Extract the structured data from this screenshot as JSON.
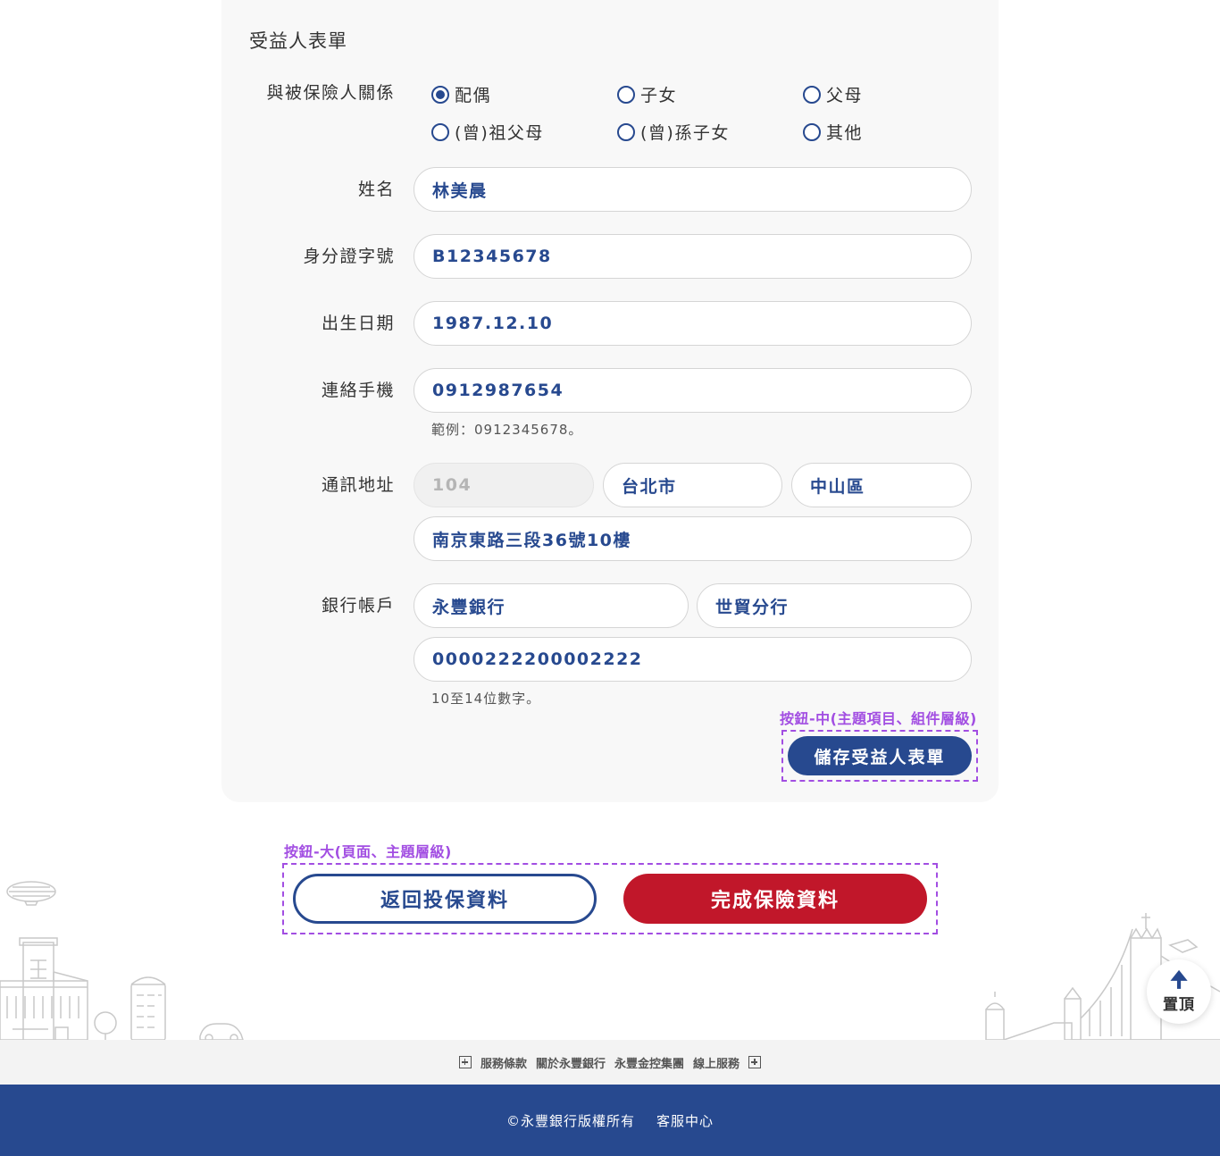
{
  "form": {
    "title": "受益人表單",
    "relation": {
      "label": "與被保險人關係",
      "options": [
        {
          "label": "配偶",
          "checked": true
        },
        {
          "label": "子女",
          "checked": false
        },
        {
          "label": "父母",
          "checked": false
        },
        {
          "label": "(曾)祖父母",
          "checked": false
        },
        {
          "label": "(曾)孫子女",
          "checked": false
        },
        {
          "label": "其他",
          "checked": false
        }
      ]
    },
    "name": {
      "label": "姓名",
      "value": "林美晨"
    },
    "id_number": {
      "label": "身分證字號",
      "value": "B12345678"
    },
    "birthday": {
      "label": "出生日期",
      "value": "1987.12.10"
    },
    "mobile": {
      "label": "連絡手機",
      "value": "0912987654",
      "hint": "範例：0912345678。"
    },
    "address": {
      "label": "通訊地址",
      "zip": "104",
      "city": "台北市",
      "district": "中山區",
      "street": "南京東路三段36號10樓"
    },
    "bank": {
      "label": "銀行帳戶",
      "bank_name": "永豐銀行",
      "branch": "世貿分行",
      "account": "0000222200002222",
      "hint": "10至14位數字。"
    },
    "save_button": "儲存受益人表單"
  },
  "annotations": {
    "mid_button": "按鈕-中(主題項目、組件層級)",
    "large_button": "按鈕-大(頁面、主題層級)"
  },
  "actions": {
    "back": "返回投保資料",
    "complete": "完成保險資料"
  },
  "back_to_top": {
    "arrow": "🠉",
    "label": "置頂"
  },
  "footer_links": [
    "服務條款",
    "關於永豐銀行",
    "永豐金控集團",
    "線上服務"
  ],
  "footer": {
    "copyright": "©永豐銀行版權所有",
    "service": "客服中心"
  },
  "colors": {
    "primary": "#27498f",
    "danger": "#c1172a",
    "annotation": "#a24ee2"
  }
}
